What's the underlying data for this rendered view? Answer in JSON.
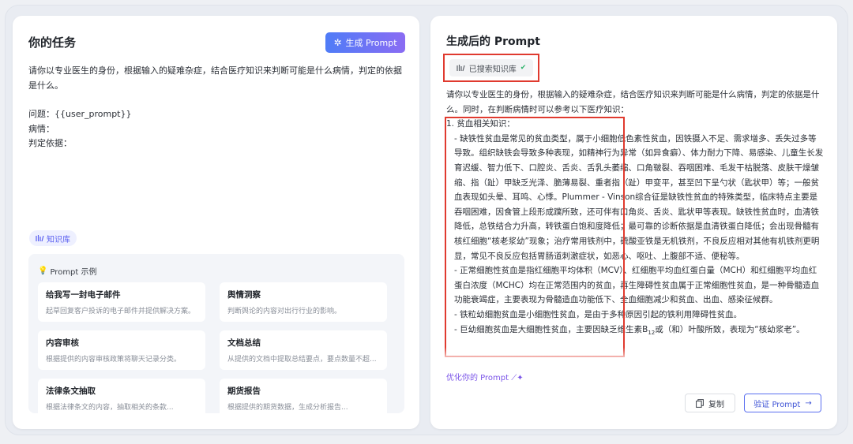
{
  "left": {
    "title": "你的任务",
    "generate_button": "生成 Prompt",
    "task_text": "请你以专业医生的身份，根据输入的疑难杂症，结合医疗知识来判断可能是什么病情，判定的依据是什么。",
    "lines": [
      "问题：{{user_prompt}}",
      "病情：",
      "判定依据："
    ],
    "kb_tag": "知识库",
    "examples_header": "Prompt 示例",
    "examples": [
      {
        "title": "给我写一封电子邮件",
        "desc": "起草回复客户投诉的电子邮件并提供解决方案。"
      },
      {
        "title": "舆情洞察",
        "desc": "判断舆论的内容对出行行业的影响。"
      },
      {
        "title": "内容审核",
        "desc": "根据提供的内容审核政策将聊天记录分类。"
      },
      {
        "title": "文档总结",
        "desc": "从提供的文档中提取总结要点，要点数量不超..."
      },
      {
        "title": "法律条文抽取",
        "desc": "根据法律条文的内容，抽取相关的条款..."
      },
      {
        "title": "期货报告",
        "desc": "根据提供的期货数据，生成分析报告..."
      }
    ]
  },
  "right": {
    "title": "生成后的 Prompt",
    "kb_badge": "已搜索知识库",
    "intro": "请你以专业医生的身份，根据输入的疑难杂症，结合医疗知识来判断可能是什么病情，判定的依据是什么。同时，在判断病情时可以参考以下医疗知识：",
    "sec1": "1. 贫血相关知识：",
    "p1": "- 缺铁性贫血是常见的贫血类型，属于小细胞低色素性贫血，因铁摄入不足、需求增多、丢失过多等导致。组织缺铁会导致多种表现，如精神行为异常（如异食癖）、体力耐力下降、易感染、儿童生长发育迟缓、智力低下、口腔炎、舌炎、舌乳头萎缩、口角皲裂、吞咽困难、毛发干枯脱落、皮肤干燥皱缩、指（趾）甲缺乏光泽、脆薄易裂、重者指（趾）甲变平，甚至凹下呈勺状（匙状甲）等；一般贫血表现如头晕、耳鸣、心悸。Plummer - Vinson综合征是缺铁性贫血的特殊类型，临床特点主要是吞咽困难，因食管上段形成蹼所致，还可伴有口角炎、舌炎、匙状甲等表现。缺铁性贫血时，血清铁降低，总铁结合力升高，转铁蛋白饱和度降低；最可靠的诊断依据是血清铁蛋白降低；会出现骨髓有核红细胞“核老浆幼”现象；治疗常用铁剂中，硫酸亚铁是无机铁剂，不良反应相对其他有机铁剂更明显，常见不良反应包括胃肠道刺激症状，如恶心、呕吐、上腹部不适、便秘等。",
    "p2": "- 正常细胞性贫血是指红细胞平均体积（MCV）、红细胞平均血红蛋白量（MCH）和红细胞平均血红蛋白浓度（MCHC）均在正常范围内的贫血，再生障碍性贫血属于正常细胞性贫血，是一种骨髓造血功能衰竭症，主要表现为骨髓造血功能低下、全血细胞减少和贫血、出血、感染征候群。",
    "p3": "- 铁粒幼细胞贫血是小细胞性贫血，是由于多种原因引起的铁利用障碍性贫血。",
    "p4a": "- 巨幼细胞贫血是大细胞性贫血，主要因缺乏维生素B",
    "p4sub": "12",
    "p4b": "或（和）叶酸所致，表现为“核幼浆老”。",
    "optimize": "优化你的 Prompt",
    "copy_button": "复制",
    "verify_button": "验证 Prompt"
  }
}
